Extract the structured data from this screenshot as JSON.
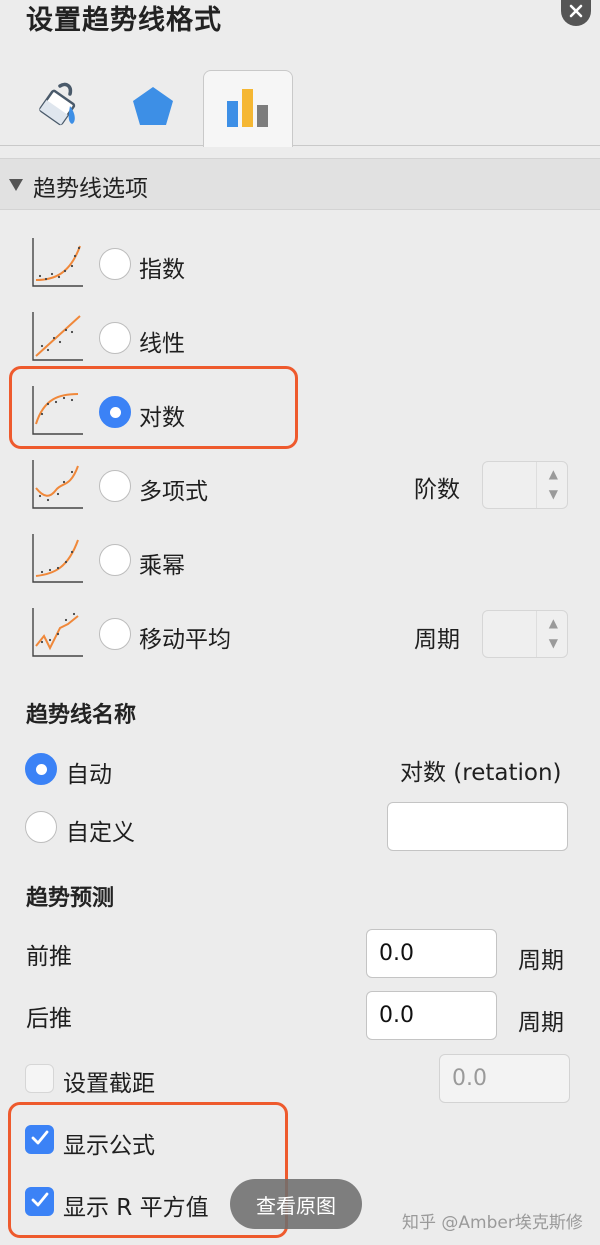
{
  "panel": {
    "title": "设置趋势线格式",
    "section_title": "趋势线选项"
  },
  "tabs": [
    {
      "icon": "paint-bucket-icon",
      "active": false
    },
    {
      "icon": "pentagon-icon",
      "active": false
    },
    {
      "icon": "bar-chart-icon",
      "active": true
    }
  ],
  "trendline_types": [
    {
      "label": "指数",
      "selected": false,
      "icon": "exponential-trend-icon"
    },
    {
      "label": "线性",
      "selected": false,
      "icon": "linear-trend-icon"
    },
    {
      "label": "对数",
      "selected": true,
      "icon": "logarithmic-trend-icon"
    },
    {
      "label": "多项式",
      "selected": false,
      "icon": "polynomial-trend-icon",
      "param_label": "阶数",
      "param_value": ""
    },
    {
      "label": "乘幂",
      "selected": false,
      "icon": "power-trend-icon"
    },
    {
      "label": "移动平均",
      "selected": false,
      "icon": "moving-average-trend-icon",
      "param_label": "周期",
      "param_value": ""
    }
  ],
  "name_section": {
    "title": "趋势线名称",
    "auto_label": "自动",
    "auto_value": "对数 (retation)",
    "custom_label": "自定义",
    "custom_value": "",
    "selected": "auto"
  },
  "forecast": {
    "title": "趋势预测",
    "forward_label": "前推",
    "forward_value": "0.0",
    "forward_unit": "周期",
    "backward_label": "后推",
    "backward_value": "0.0",
    "backward_unit": "周期",
    "intercept_label": "设置截距",
    "intercept_checked": false,
    "intercept_value": "0.0"
  },
  "display": {
    "equation_label": "显示公式",
    "equation_checked": true,
    "rsquared_label": "显示 R 平方值",
    "rsquared_checked": true
  },
  "overlay": {
    "view_original_label": "查看原图",
    "watermark": "知乎 @Amber埃克斯修"
  },
  "colors": {
    "accent": "#3b82f6",
    "highlight": "#ee5a2d",
    "trend_curve": "#f0883a"
  }
}
